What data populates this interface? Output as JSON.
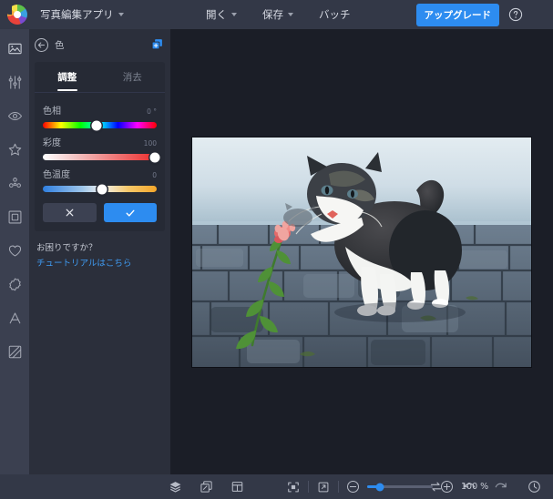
{
  "titlebar": {
    "logo_icon": "color-wheel-logo",
    "app_name": "写真編集アプリ",
    "menu": [
      {
        "label": "開く",
        "has_caret": true
      },
      {
        "label": "保存",
        "has_caret": true
      },
      {
        "label": "バッチ",
        "has_caret": false
      }
    ],
    "upgrade_label": "アップグレード",
    "help_icon": "question-circle-icon",
    "menu_icon": "hamburger-menu-icon",
    "accent_color": "#2d8cf0"
  },
  "rail": {
    "items": [
      {
        "name": "image",
        "icon": "image-icon",
        "active": true
      },
      {
        "name": "adjust",
        "icon": "sliders-icon",
        "active": false
      },
      {
        "name": "retouch",
        "icon": "eye-icon",
        "active": false
      },
      {
        "name": "effects",
        "icon": "star-icon",
        "active": false
      },
      {
        "name": "particles",
        "icon": "dots-cluster-icon",
        "active": false
      },
      {
        "name": "frame",
        "icon": "frame-icon",
        "active": false
      },
      {
        "name": "favorites",
        "icon": "heart-icon",
        "active": false
      },
      {
        "name": "stickers",
        "icon": "badge-icon",
        "active": false
      },
      {
        "name": "text",
        "icon": "text-a-icon",
        "active": false
      },
      {
        "name": "texture",
        "icon": "texture-icon",
        "active": false
      }
    ]
  },
  "panel": {
    "back_icon": "back-arrow-circle-icon",
    "title": "色",
    "copy_icon": "duplicate-layers-icon",
    "tabs": [
      {
        "label": "調整",
        "active": true
      },
      {
        "label": "消去",
        "active": false
      }
    ],
    "sliders": [
      {
        "label": "色相",
        "value": "0 °",
        "position_pct": 47,
        "type": "hue"
      },
      {
        "label": "彩度",
        "value": "100",
        "position_pct": 98,
        "type": "sat"
      },
      {
        "label": "色温度",
        "value": "0",
        "position_pct": 52,
        "type": "temp"
      }
    ],
    "cancel_icon": "close-x-icon",
    "confirm_icon": "check-icon",
    "help_question": "お困りですか？",
    "help_link": "チュートリアルはこちら",
    "link_color": "#3f9bf2"
  },
  "canvas": {
    "image_alt": "子猫が花に触れている写真"
  },
  "bottombar": {
    "left_icons": [
      {
        "name": "layers",
        "icon": "layers-icon"
      },
      {
        "name": "compare",
        "icon": "compare-copy-icon"
      },
      {
        "name": "panel-layout",
        "icon": "panel-layout-icon"
      }
    ],
    "view_icons": [
      {
        "name": "fit-to-screen",
        "icon": "fit-screen-icon"
      },
      {
        "name": "fullscreen",
        "icon": "expand-arrow-icon"
      }
    ],
    "zoom_out_icon": "minus-circle-icon",
    "zoom_in_icon": "plus-circle-icon",
    "zoom_level": "100 %",
    "zoom_position_pct": 19,
    "right_icons": [
      {
        "name": "before-after-toggle",
        "icon": "swap-arrows-icon"
      },
      {
        "name": "undo",
        "icon": "undo-arrow-icon"
      },
      {
        "name": "redo",
        "icon": "redo-arrow-icon"
      },
      {
        "name": "history",
        "icon": "clock-icon"
      }
    ]
  }
}
